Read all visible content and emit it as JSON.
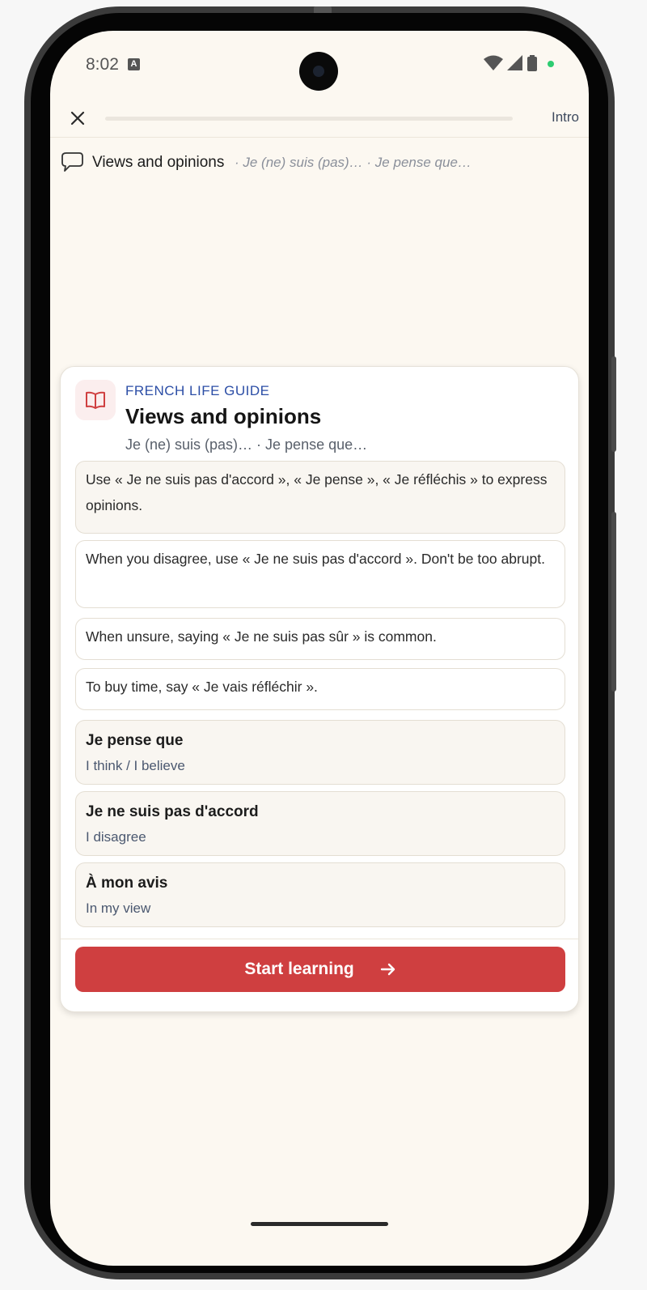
{
  "status_bar": {
    "time": "8:02",
    "notification_icon": "A",
    "icons": [
      "wifi-icon",
      "signal-icon",
      "battery-icon"
    ],
    "dot_color": "#2ecc71"
  },
  "top_bar": {
    "close_icon": "close-icon",
    "progress_fraction": 0.0,
    "step_label": "Intro"
  },
  "breadcrumb": {
    "icon": "speech-bubble-icon",
    "title": "Views and opinions",
    "subtitle": "· Je (ne) suis (pas)… · Je pense que…"
  },
  "card": {
    "icon": "book-icon",
    "eyebrow": "FRENCH LIFE GUIDE",
    "title": "Views and opinions",
    "subtitle": "Je (ne) suis (pas)… · Je pense que…",
    "tips": [
      "Use « Je ne suis pas d'accord », « Je pense », « Je réfléchis » to express opinions.",
      "When you disagree, use « Je ne suis pas d'accord ». Don't be too abrupt.",
      "When unsure, saying « Je ne suis pas sûr » is common.",
      "To buy time, say « Je vais réfléchir »."
    ],
    "phrases": [
      {
        "fr": "Je pense que",
        "en": "I think / I believe"
      },
      {
        "fr": "Je ne suis pas d'accord",
        "en": "I disagree"
      },
      {
        "fr": "À mon avis",
        "en": "In my view"
      }
    ],
    "cta_label": "Start learning",
    "cta_icon": "arrow-right-icon"
  },
  "colors": {
    "accent": "#cf3f40",
    "eyebrow": "#2c4ea6",
    "background": "#fcf8f1"
  }
}
